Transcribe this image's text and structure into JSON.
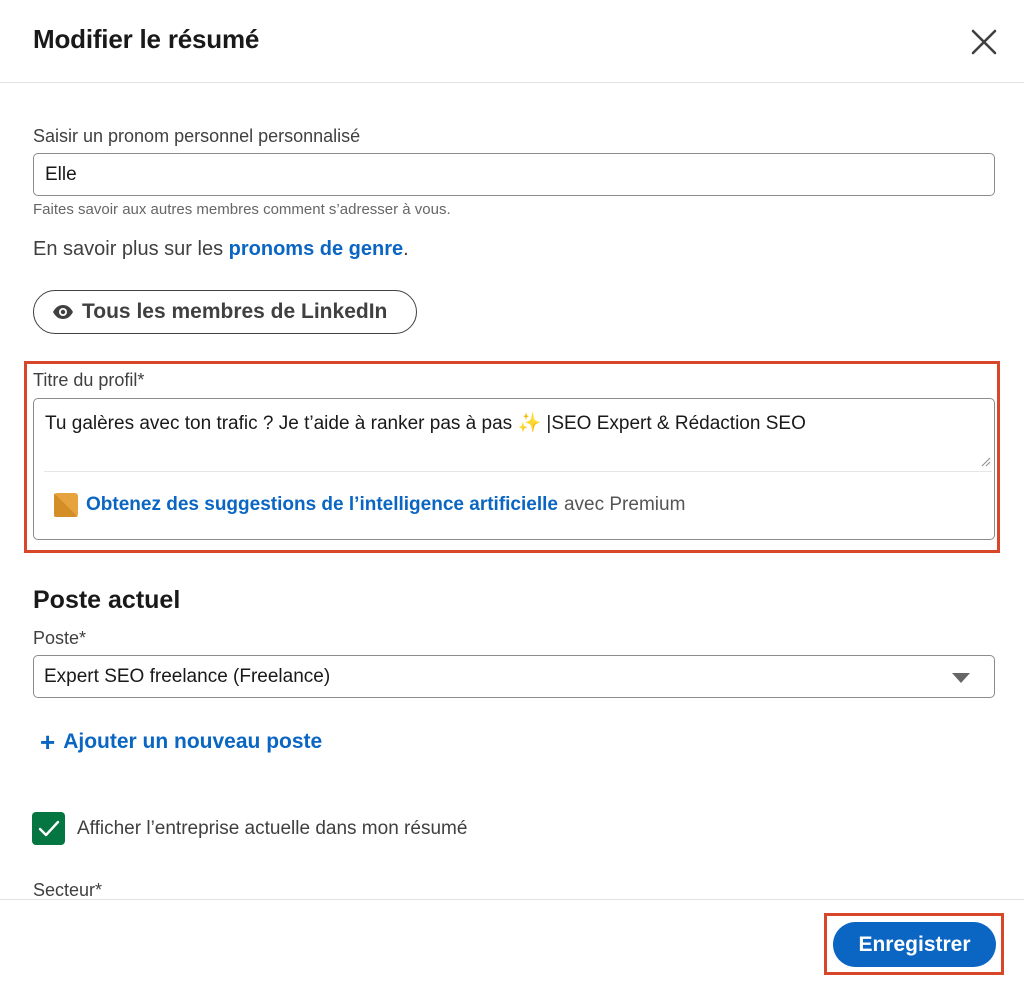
{
  "dialog": {
    "title": "Modifier le résumé",
    "close_icon": "close-icon"
  },
  "pronoun": {
    "label": "Saisir un pronom personnel personnalisé",
    "value": "Elle",
    "hint": "Faites savoir aux autres membres comment s’adresser à vous.",
    "learn_prefix": "En savoir plus sur les ",
    "learn_link": "pronoms de genre",
    "learn_suffix": "."
  },
  "visibility": {
    "icon": "eye-icon",
    "label": "Tous les membres de LinkedIn"
  },
  "headline": {
    "label": "Titre du profil*",
    "value_before": "Tu galères avec ton trafic ? Je t’aide à ranker pas à pas ",
    "sparkle": "✨",
    "value_after": " |SEO Expert & Rédaction SEO",
    "ai_icon": "premium-icon",
    "ai_link": "Obtenez des suggestions de l’intelligence artificielle",
    "ai_suffix": "avec Premium"
  },
  "current_position": {
    "section_title": "Poste actuel",
    "label": "Poste*",
    "selected": "Expert SEO freelance (Freelance)",
    "add_label": "Ajouter un nouveau poste",
    "show_company_label": "Afficher l’entreprise actuelle dans mon résumé",
    "show_company_checked": true
  },
  "industry": {
    "label": "Secteur*"
  },
  "footer": {
    "save_label": "Enregistrer"
  },
  "colors": {
    "brand_blue": "#0a66c2",
    "checkbox_green": "#057642",
    "highlight_red": "#d9472b"
  }
}
